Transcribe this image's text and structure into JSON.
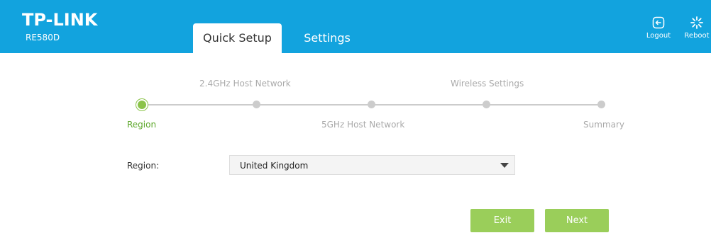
{
  "header": {
    "brand": "TP-LINK",
    "model": "RE580D",
    "tabs": [
      {
        "label": "Quick Setup",
        "active": true
      },
      {
        "label": "Settings",
        "active": false
      }
    ],
    "logout_label": "Logout",
    "reboot_label": "Reboot",
    "logout_icon": "logout-icon",
    "reboot_icon": "reboot-icon",
    "color": "#12a3de"
  },
  "wizard": {
    "current_step": 0,
    "steps": [
      {
        "label": "Region"
      },
      {
        "label": "2.4GHz Host Network"
      },
      {
        "label": "5GHz Host Network"
      },
      {
        "label": "Wireless Settings"
      },
      {
        "label": "Summary"
      }
    ],
    "active_color": "#8bc34a"
  },
  "form": {
    "region_label": "Region:",
    "region_value": "United Kingdom"
  },
  "buttons": {
    "exit_label": "Exit",
    "next_label": "Next",
    "color": "#9ace5a"
  }
}
